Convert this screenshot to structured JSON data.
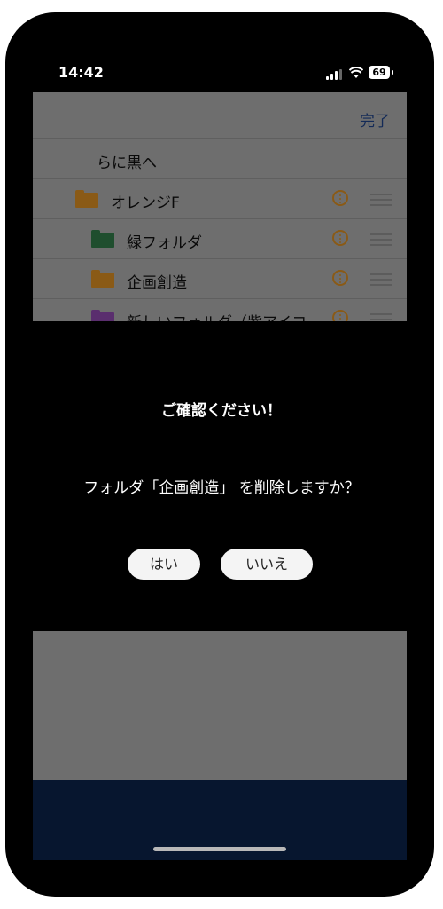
{
  "status_bar": {
    "time": "14:42",
    "battery": "69"
  },
  "sheet": {
    "done_label": "完了",
    "rows": [
      {
        "label": "らに黒へ"
      },
      {
        "label": "オレンジF",
        "folder_color": "#8a5a16"
      },
      {
        "label": "緑フォルダ",
        "folder_color": "#1f4e2e"
      },
      {
        "label": "企画創造",
        "folder_color": "#8a5a16"
      },
      {
        "label": "新しいフォルダ（紫アイコ",
        "folder_color": "#5a2e6e"
      }
    ]
  },
  "dialog": {
    "title": "ご確認ください！",
    "message": "フォルダ「企画創造」 を削除しますか？",
    "yes_label": "はい",
    "no_label": "いいえ"
  },
  "colors": {
    "accent": "#132a57",
    "info_icon": "#8a5a16",
    "tab_bar": "#07162f"
  }
}
